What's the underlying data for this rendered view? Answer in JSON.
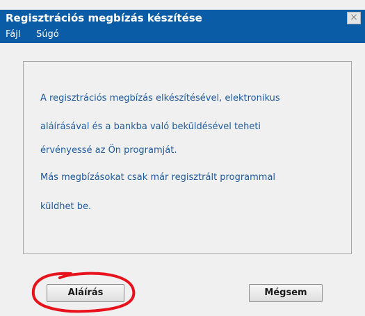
{
  "window": {
    "title": "Regisztrációs megbízás készítése",
    "close_glyph": "×"
  },
  "menu": {
    "items": [
      {
        "label": "Fájl"
      },
      {
        "label": "Súgó"
      }
    ]
  },
  "content": {
    "lines": [
      "A regisztrációs megbízás elkészítésével, elektronikus",
      "aláírásával és a bankba való beküldésével teheti",
      "érvényessé az Ön programját.",
      "Más megbízásokat csak már regisztrált programmal",
      "küldhet be."
    ]
  },
  "buttons": {
    "sign_label": "Aláírás",
    "cancel_label": "Mégsem"
  },
  "colors": {
    "titlebar": "#0a5ca6",
    "text_accent": "#1f5a9e",
    "highlight": "#e8121c"
  }
}
